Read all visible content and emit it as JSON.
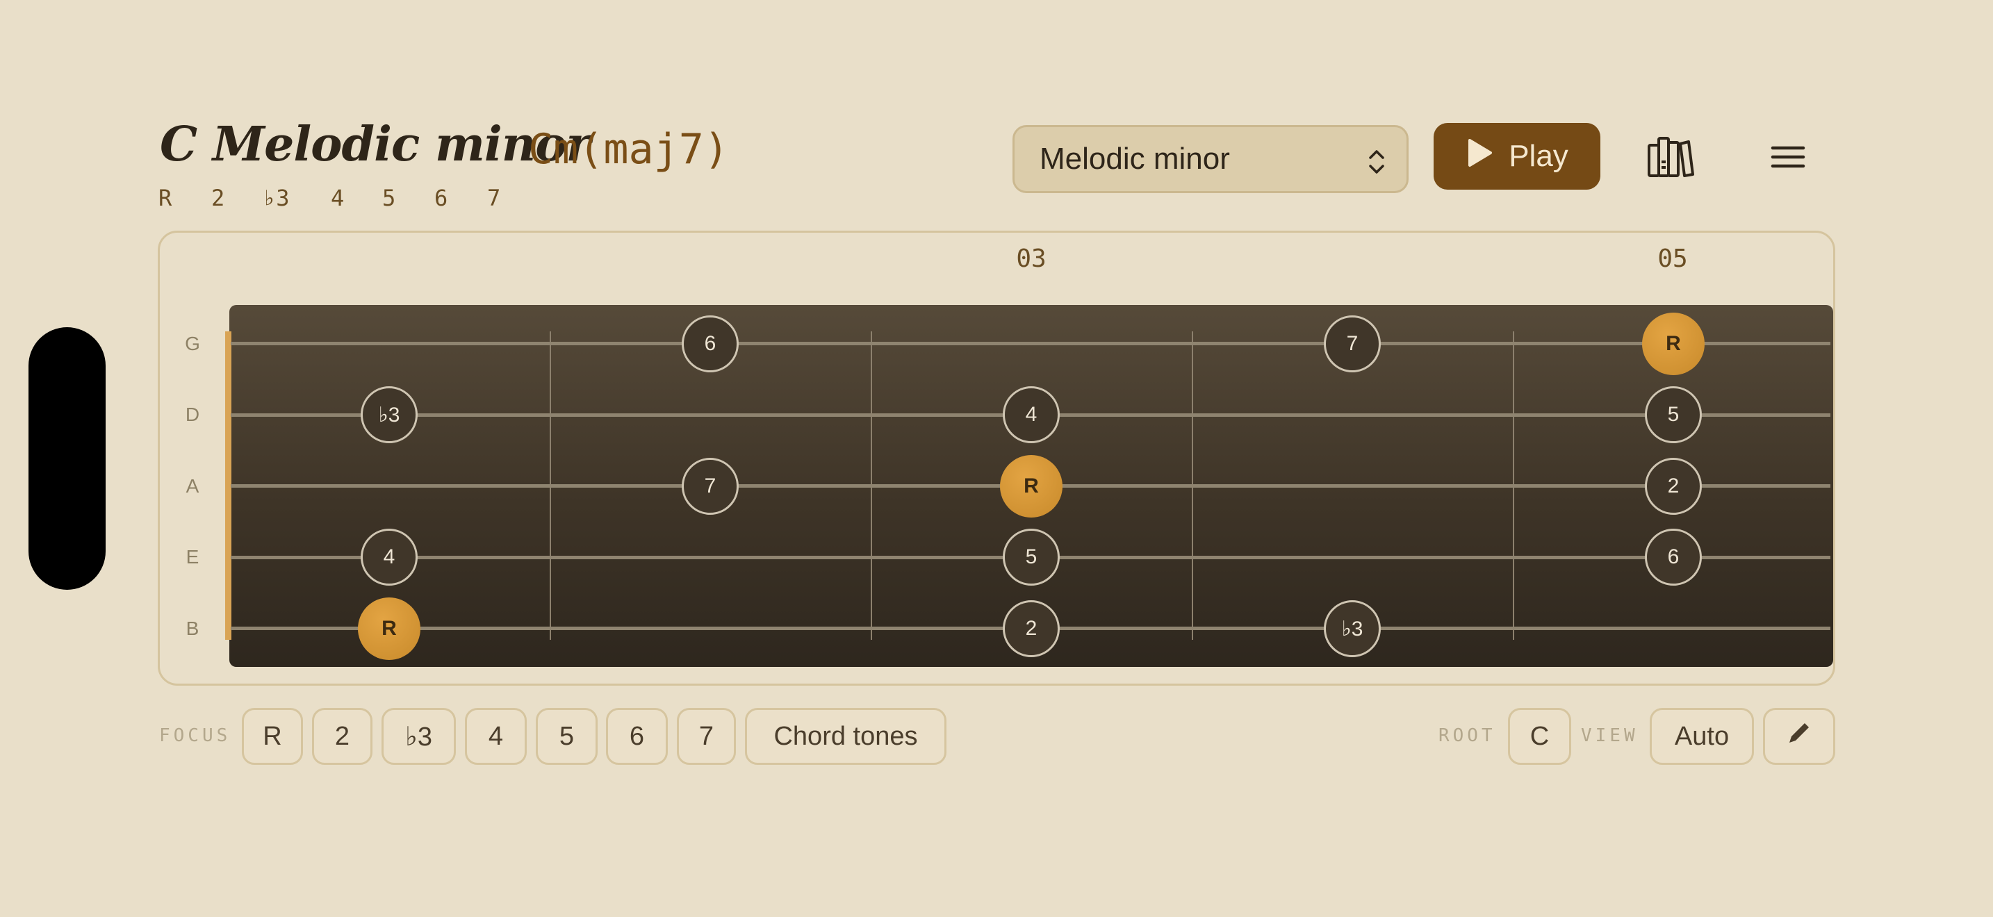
{
  "header": {
    "title": "C Melodic minor",
    "chord": "Cm(maj7)",
    "degrees": [
      "R",
      "2",
      "♭3",
      "4",
      "5",
      "6",
      "7"
    ]
  },
  "scale_select": {
    "value": "Melodic minor",
    "icon": "chevron-up-down-icon"
  },
  "play_button": {
    "label": "Play",
    "icon": "play-icon"
  },
  "toolbar_icons": [
    "library-icon",
    "menu-icon"
  ],
  "fretboard": {
    "fret_markers": [
      "03",
      "05"
    ],
    "strings": [
      "G",
      "D",
      "A",
      "E",
      "B"
    ],
    "notes": {
      "G": [
        "6",
        "7",
        "R"
      ],
      "D": [
        "♭3",
        "4",
        "5"
      ],
      "A": [
        "7",
        "R",
        "2"
      ],
      "E": [
        "4",
        "5",
        "6"
      ],
      "B": [
        "R",
        "2",
        "♭3"
      ]
    }
  },
  "focus": {
    "label": "FOCUS",
    "chips": [
      "R",
      "2",
      "♭3",
      "4",
      "5",
      "6",
      "7"
    ],
    "chord_tones": "Chord tones"
  },
  "root": {
    "label": "ROOT",
    "value": "C"
  },
  "view": {
    "label": "VIEW",
    "value": "Auto",
    "edit_icon": "pencil-icon"
  },
  "colors": {
    "accent": "#754a15",
    "root_note": "#d4962f",
    "background": "#e9dfc9",
    "fretboard": "#4a3f30"
  }
}
